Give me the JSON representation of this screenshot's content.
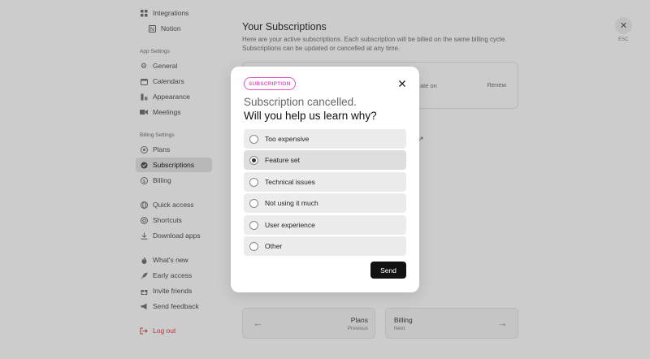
{
  "sidebar": {
    "integrations": "Integrations",
    "notion": "Notion",
    "app_settings_label": "App Settings",
    "app_items": [
      "General",
      "Calendars",
      "Appearance",
      "Meetings"
    ],
    "billing_settings_label": "Billing Settings",
    "billing_items": [
      "Plans",
      "Subscriptions",
      "Billing"
    ],
    "misc_items": [
      "Quick access",
      "Shortcuts",
      "Download apps"
    ],
    "extra_items": [
      "What's new",
      "Early access",
      "Invite friends",
      "Send feedback"
    ],
    "logout": "Log out"
  },
  "main": {
    "title": "Your Subscriptions",
    "description": "Here are your active subscriptions. Each subscription will be billed on the same billing cycle. Subscriptions can be updated or cancelled at any time.",
    "card_date_partial": "ate on",
    "card_renew": "Renew",
    "esc_label": "ESC",
    "prev": {
      "title": "Plans",
      "sub": "Previous"
    },
    "next": {
      "title": "Billing",
      "sub": "Next"
    }
  },
  "modal": {
    "badge": "SUBSCRIPTION",
    "headline_line1": "Subscription cancelled.",
    "headline_line2": "Will you help us learn why?",
    "options": [
      "Too expensive",
      "Feature set",
      "Technical issues",
      "Not using it much",
      "User experience",
      "Other"
    ],
    "selected_option": "Feature set",
    "send_label": "Send"
  },
  "colors": {
    "badge_accent": "#e356c3",
    "logout_red": "#e04a4a",
    "send_button": "#121212"
  }
}
